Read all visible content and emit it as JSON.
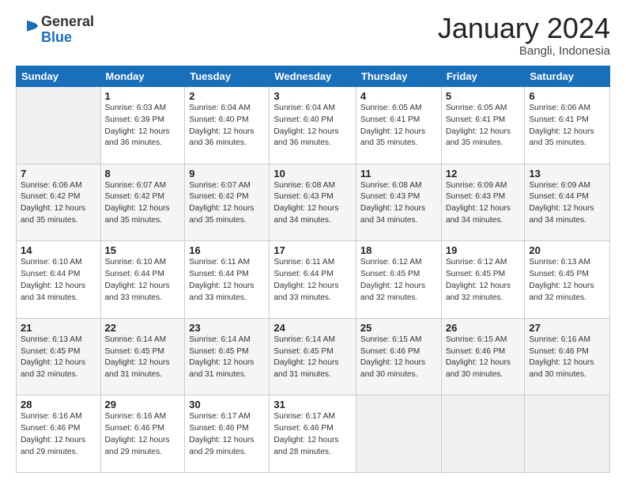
{
  "header": {
    "logo_general": "General",
    "logo_blue": "Blue",
    "month_title": "January 2024",
    "location": "Bangli, Indonesia"
  },
  "days_of_week": [
    "Sunday",
    "Monday",
    "Tuesday",
    "Wednesday",
    "Thursday",
    "Friday",
    "Saturday"
  ],
  "weeks": [
    [
      {
        "day": "",
        "content": ""
      },
      {
        "day": "1",
        "content": "Sunrise: 6:03 AM\nSunset: 6:39 PM\nDaylight: 12 hours\nand 36 minutes."
      },
      {
        "day": "2",
        "content": "Sunrise: 6:04 AM\nSunset: 6:40 PM\nDaylight: 12 hours\nand 36 minutes."
      },
      {
        "day": "3",
        "content": "Sunrise: 6:04 AM\nSunset: 6:40 PM\nDaylight: 12 hours\nand 36 minutes."
      },
      {
        "day": "4",
        "content": "Sunrise: 6:05 AM\nSunset: 6:41 PM\nDaylight: 12 hours\nand 35 minutes."
      },
      {
        "day": "5",
        "content": "Sunrise: 6:05 AM\nSunset: 6:41 PM\nDaylight: 12 hours\nand 35 minutes."
      },
      {
        "day": "6",
        "content": "Sunrise: 6:06 AM\nSunset: 6:41 PM\nDaylight: 12 hours\nand 35 minutes."
      }
    ],
    [
      {
        "day": "7",
        "content": "Sunrise: 6:06 AM\nSunset: 6:42 PM\nDaylight: 12 hours\nand 35 minutes."
      },
      {
        "day": "8",
        "content": "Sunrise: 6:07 AM\nSunset: 6:42 PM\nDaylight: 12 hours\nand 35 minutes."
      },
      {
        "day": "9",
        "content": "Sunrise: 6:07 AM\nSunset: 6:42 PM\nDaylight: 12 hours\nand 35 minutes."
      },
      {
        "day": "10",
        "content": "Sunrise: 6:08 AM\nSunset: 6:43 PM\nDaylight: 12 hours\nand 34 minutes."
      },
      {
        "day": "11",
        "content": "Sunrise: 6:08 AM\nSunset: 6:43 PM\nDaylight: 12 hours\nand 34 minutes."
      },
      {
        "day": "12",
        "content": "Sunrise: 6:09 AM\nSunset: 6:43 PM\nDaylight: 12 hours\nand 34 minutes."
      },
      {
        "day": "13",
        "content": "Sunrise: 6:09 AM\nSunset: 6:44 PM\nDaylight: 12 hours\nand 34 minutes."
      }
    ],
    [
      {
        "day": "14",
        "content": "Sunrise: 6:10 AM\nSunset: 6:44 PM\nDaylight: 12 hours\nand 34 minutes."
      },
      {
        "day": "15",
        "content": "Sunrise: 6:10 AM\nSunset: 6:44 PM\nDaylight: 12 hours\nand 33 minutes."
      },
      {
        "day": "16",
        "content": "Sunrise: 6:11 AM\nSunset: 6:44 PM\nDaylight: 12 hours\nand 33 minutes."
      },
      {
        "day": "17",
        "content": "Sunrise: 6:11 AM\nSunset: 6:44 PM\nDaylight: 12 hours\nand 33 minutes."
      },
      {
        "day": "18",
        "content": "Sunrise: 6:12 AM\nSunset: 6:45 PM\nDaylight: 12 hours\nand 32 minutes."
      },
      {
        "day": "19",
        "content": "Sunrise: 6:12 AM\nSunset: 6:45 PM\nDaylight: 12 hours\nand 32 minutes."
      },
      {
        "day": "20",
        "content": "Sunrise: 6:13 AM\nSunset: 6:45 PM\nDaylight: 12 hours\nand 32 minutes."
      }
    ],
    [
      {
        "day": "21",
        "content": "Sunrise: 6:13 AM\nSunset: 6:45 PM\nDaylight: 12 hours\nand 32 minutes."
      },
      {
        "day": "22",
        "content": "Sunrise: 6:14 AM\nSunset: 6:45 PM\nDaylight: 12 hours\nand 31 minutes."
      },
      {
        "day": "23",
        "content": "Sunrise: 6:14 AM\nSunset: 6:45 PM\nDaylight: 12 hours\nand 31 minutes."
      },
      {
        "day": "24",
        "content": "Sunrise: 6:14 AM\nSunset: 6:45 PM\nDaylight: 12 hours\nand 31 minutes."
      },
      {
        "day": "25",
        "content": "Sunrise: 6:15 AM\nSunset: 6:46 PM\nDaylight: 12 hours\nand 30 minutes."
      },
      {
        "day": "26",
        "content": "Sunrise: 6:15 AM\nSunset: 6:46 PM\nDaylight: 12 hours\nand 30 minutes."
      },
      {
        "day": "27",
        "content": "Sunrise: 6:16 AM\nSunset: 6:46 PM\nDaylight: 12 hours\nand 30 minutes."
      }
    ],
    [
      {
        "day": "28",
        "content": "Sunrise: 6:16 AM\nSunset: 6:46 PM\nDaylight: 12 hours\nand 29 minutes."
      },
      {
        "day": "29",
        "content": "Sunrise: 6:16 AM\nSunset: 6:46 PM\nDaylight: 12 hours\nand 29 minutes."
      },
      {
        "day": "30",
        "content": "Sunrise: 6:17 AM\nSunset: 6:46 PM\nDaylight: 12 hours\nand 29 minutes."
      },
      {
        "day": "31",
        "content": "Sunrise: 6:17 AM\nSunset: 6:46 PM\nDaylight: 12 hours\nand 28 minutes."
      },
      {
        "day": "",
        "content": ""
      },
      {
        "day": "",
        "content": ""
      },
      {
        "day": "",
        "content": ""
      }
    ]
  ]
}
